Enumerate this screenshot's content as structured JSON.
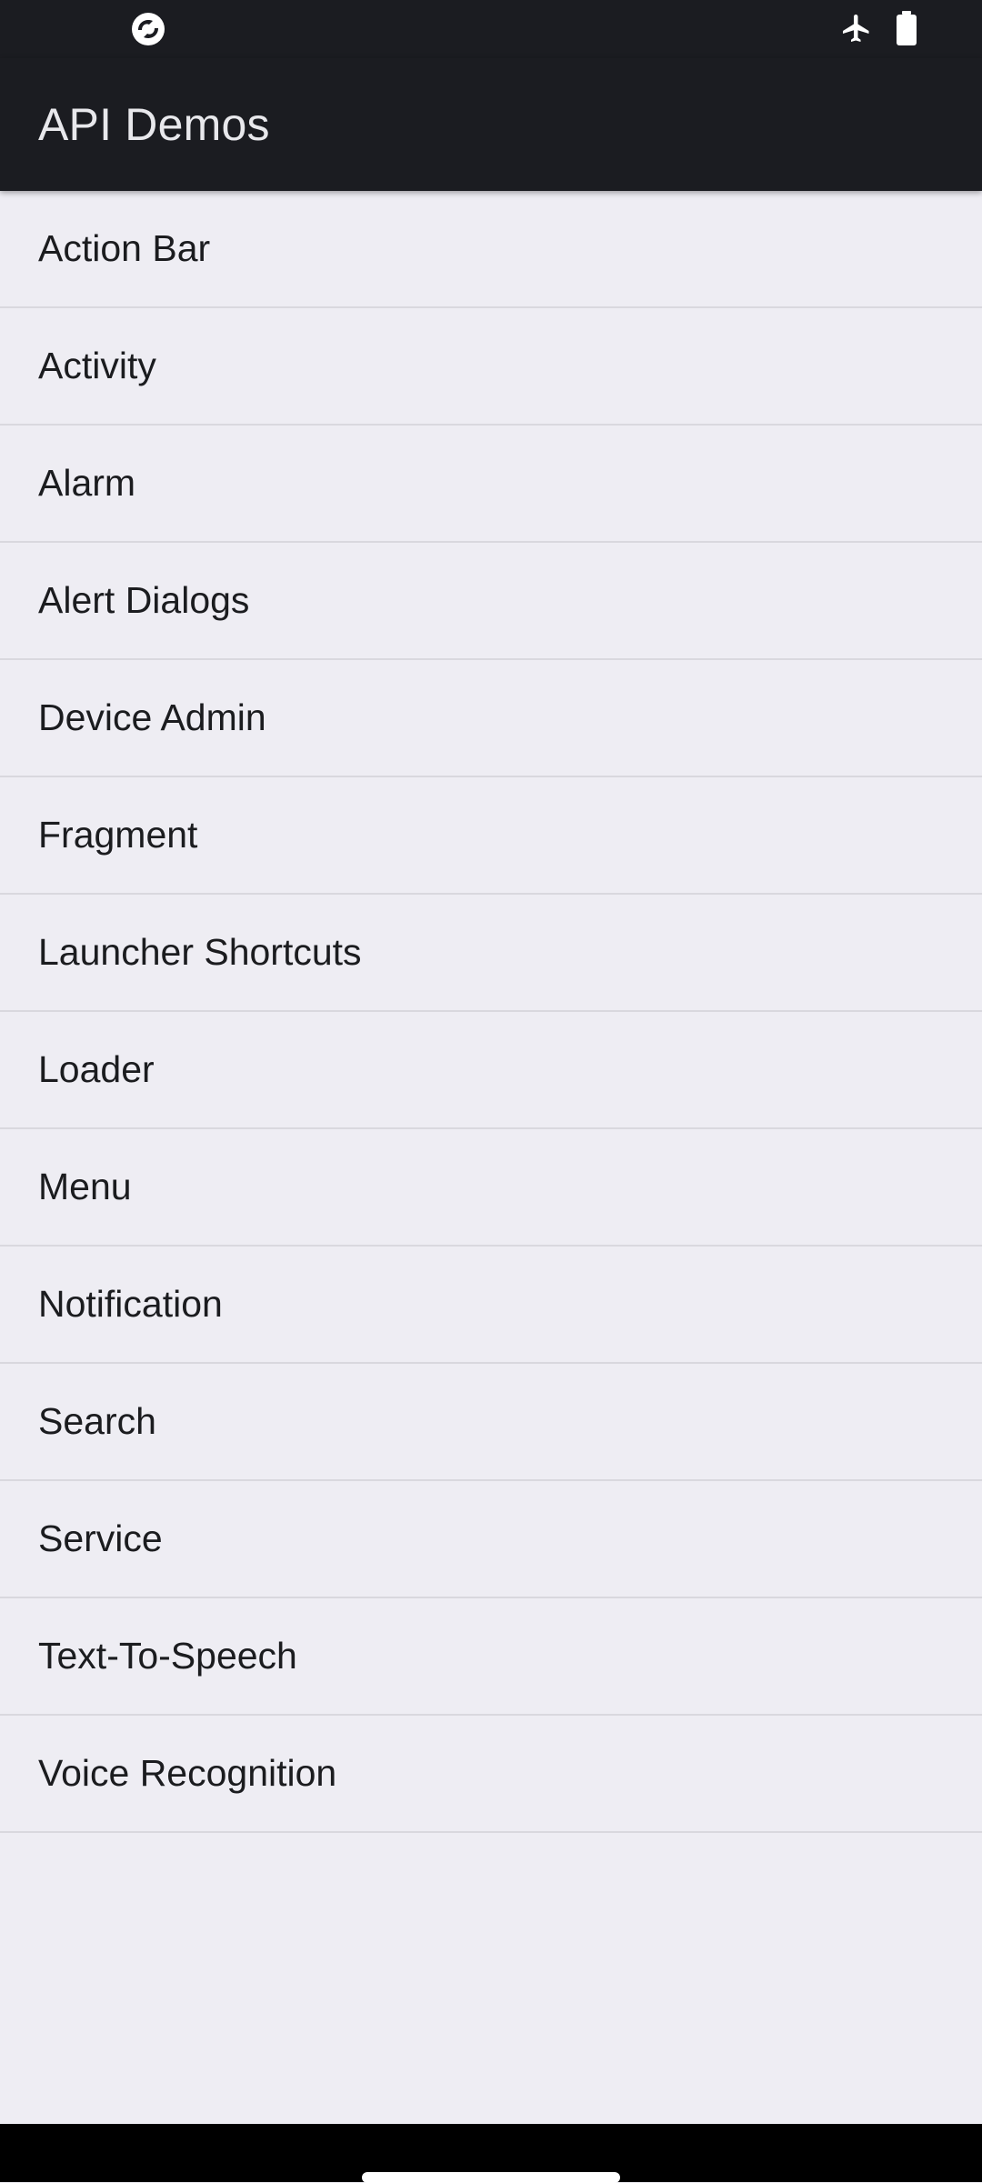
{
  "app_bar": {
    "title": "API Demos"
  },
  "status_bar": {
    "left_icon": "app-notification-icon",
    "right_icons": [
      "airplane-mode-icon",
      "battery-icon"
    ]
  },
  "list": {
    "items": [
      "Action Bar",
      "Activity",
      "Alarm",
      "Alert Dialogs",
      "Device Admin",
      "Fragment",
      "Launcher Shortcuts",
      "Loader",
      "Menu",
      "Notification",
      "Search",
      "Service",
      "Text-To-Speech",
      "Voice Recognition"
    ]
  },
  "colors": {
    "bar_background": "#1b1c21",
    "list_background": "#eeedf3",
    "divider": "#d9d8de",
    "text": "#1b1c1f"
  }
}
